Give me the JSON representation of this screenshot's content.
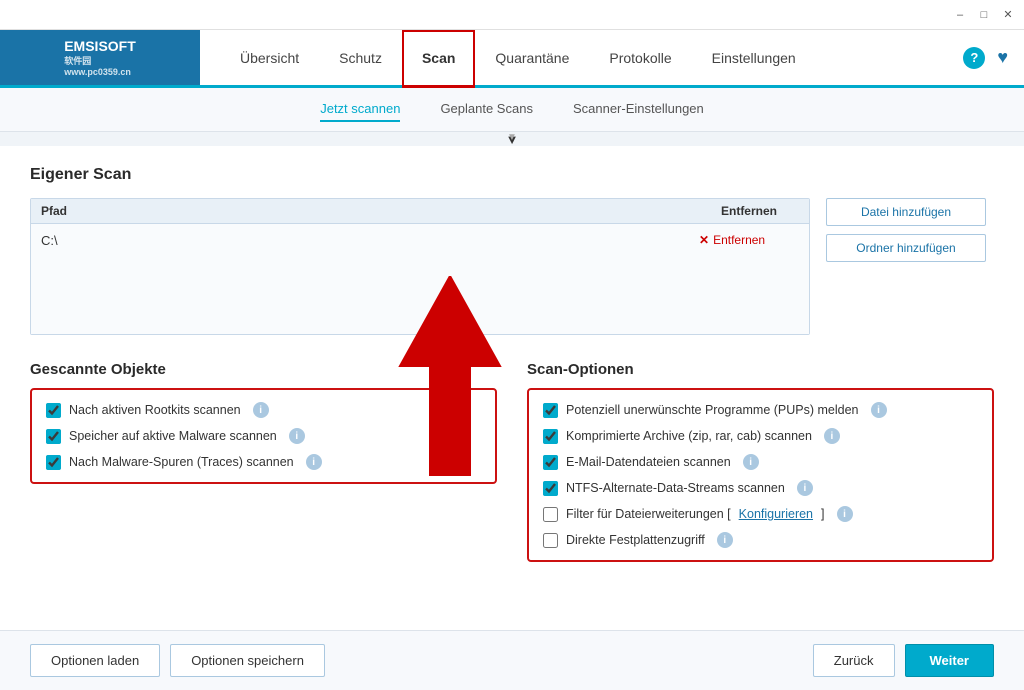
{
  "titleBar": {
    "minimize": "–",
    "maximize": "□",
    "close": "✕"
  },
  "navBar": {
    "logo": {
      "line1": "EMSISOFT",
      "line2": "软件园",
      "line3": "www.pc0359.cn"
    },
    "items": [
      {
        "label": "Übersicht",
        "active": false
      },
      {
        "label": "Schutz",
        "active": false
      },
      {
        "label": "Scan",
        "active": true
      },
      {
        "label": "Quarantäne",
        "active": false
      },
      {
        "label": "Protokolle",
        "active": false
      },
      {
        "label": "Einstellungen",
        "active": false
      }
    ],
    "help": "?",
    "heart": "♥"
  },
  "subNav": {
    "items": [
      {
        "label": "Jetzt scannen",
        "active": true
      },
      {
        "label": "Geplante Scans",
        "active": false
      },
      {
        "label": "Scanner-Einstellungen",
        "active": false
      }
    ]
  },
  "main": {
    "sectionTitle": "Eigener Scan",
    "pathTable": {
      "headers": {
        "path": "Pfad",
        "remove": "Entfernen"
      },
      "rows": [
        {
          "path": "C:\\",
          "removeLabel": "Entfernen"
        }
      ]
    },
    "buttons": {
      "addFile": "Datei hinzufügen",
      "addFolder": "Ordner hinzufügen"
    },
    "leftSection": {
      "title": "Gescannte Objekte",
      "items": [
        {
          "label": "Nach aktiven Rootkits scannen",
          "checked": true
        },
        {
          "label": "Speicher auf aktive Malware scannen",
          "checked": true
        },
        {
          "label": "Nach Malware-Spuren (Traces) scannen",
          "checked": true
        }
      ]
    },
    "rightSection": {
      "title": "Scan-Optionen",
      "items": [
        {
          "label": "Potenziell unerwünschte Programme (PUPs) melden",
          "checked": true,
          "hasLink": false
        },
        {
          "label": "Komprimierte Archive (zip, rar, cab) scannen",
          "checked": true,
          "hasLink": false
        },
        {
          "label": "E-Mail-Datendateien scannen",
          "checked": true,
          "hasLink": false
        },
        {
          "label": "NTFS-Alternate-Data-Streams scannen",
          "checked": true,
          "hasLink": false
        },
        {
          "label": "Filter für Dateierweiterungen [",
          "linkText": "Konfigurieren",
          "labelEnd": "]",
          "checked": false,
          "hasLink": true
        },
        {
          "label": "Direkte Festplattenzugriff",
          "checked": false,
          "hasLink": false
        }
      ]
    }
  },
  "bottomBar": {
    "optionenLaden": "Optionen laden",
    "optionenSpeichern": "Optionen speichern",
    "zurueck": "Zurück",
    "weiter": "Weiter"
  }
}
